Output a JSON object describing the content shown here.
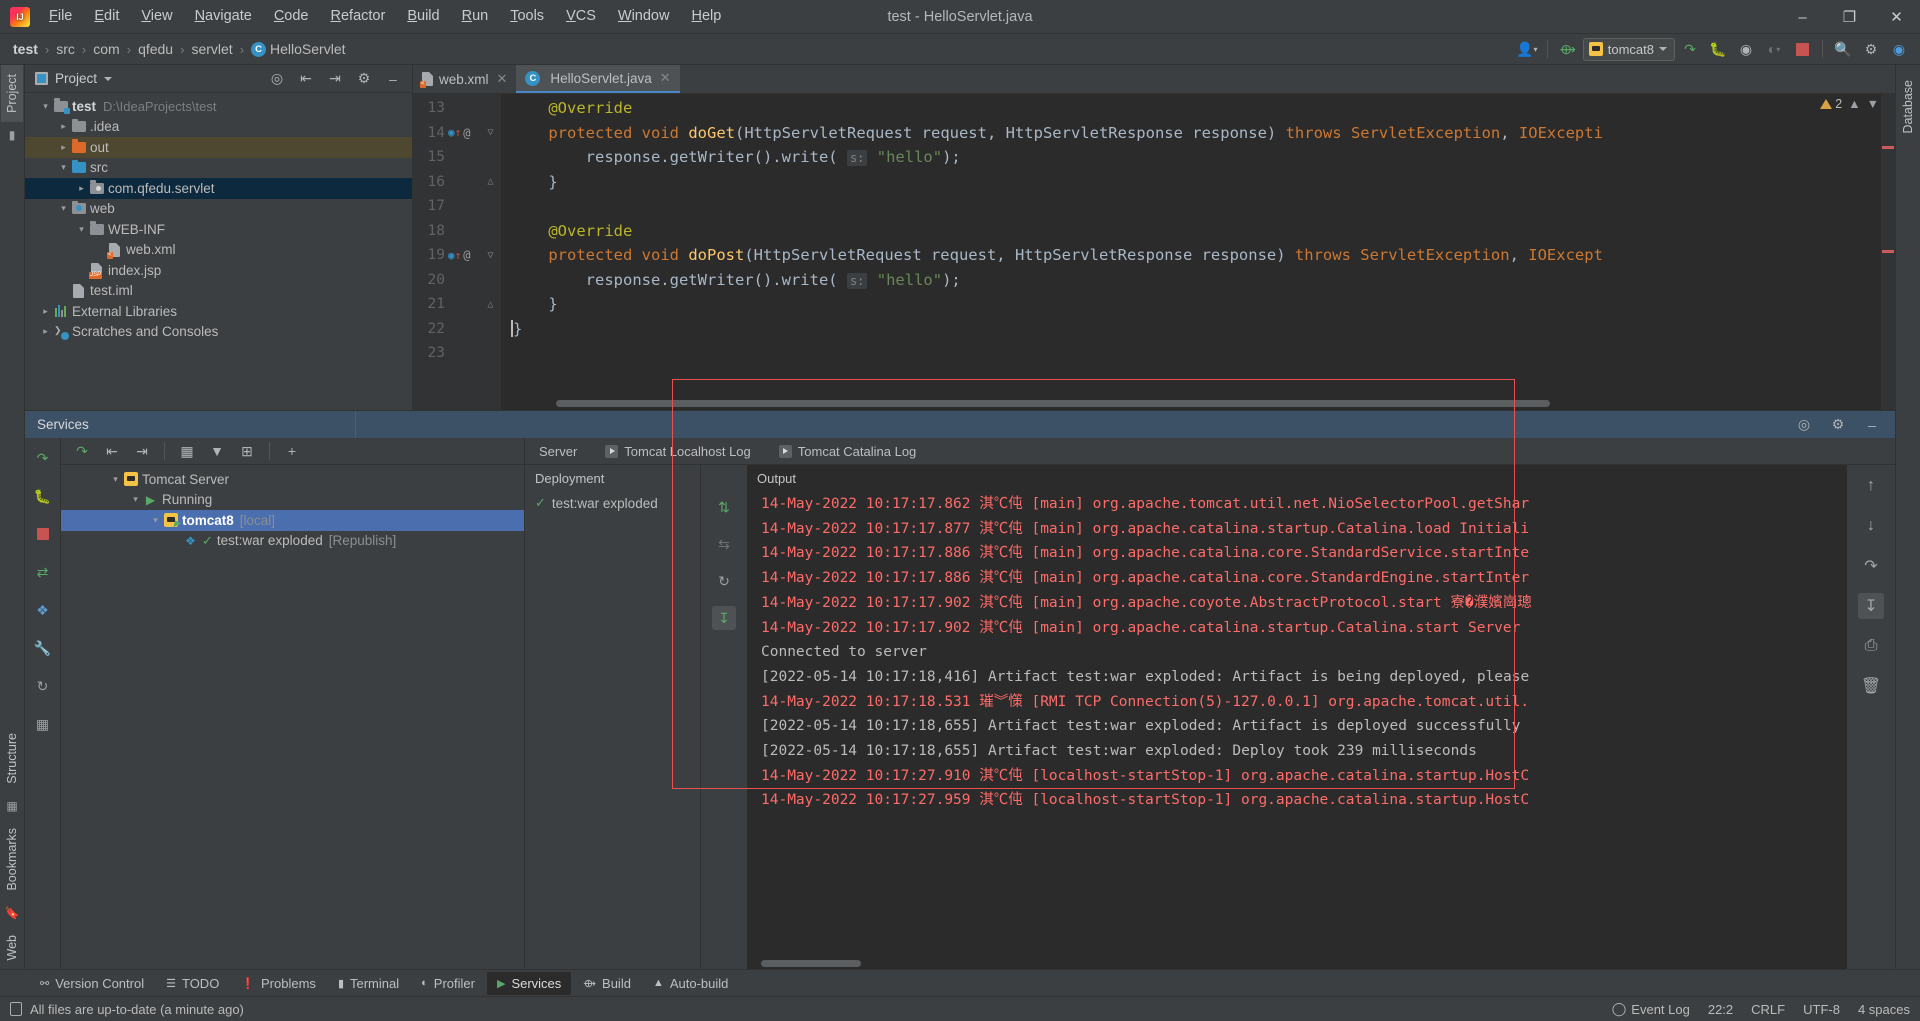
{
  "titlebar": {
    "logo_icon": "intellij-logo-icon",
    "window_title": "test - HelloServlet.java",
    "menus": [
      "File",
      "Edit",
      "View",
      "Navigate",
      "Code",
      "Refactor",
      "Build",
      "Run",
      "Tools",
      "VCS",
      "Window",
      "Help"
    ],
    "minimize_icon": "minimize-icon",
    "restore_icon": "restore-icon",
    "close_icon": "close-icon"
  },
  "navbar": {
    "breadcrumbs": [
      "test",
      "src",
      "com",
      "qfedu",
      "servlet",
      "HelloServlet"
    ],
    "class_badge": "C",
    "separator": "›",
    "run_config": "tomcat8",
    "icons": [
      "user-icon",
      "build-hammer-icon",
      "run-icon",
      "debug-icon",
      "run-coverage-icon",
      "profiler-icon",
      "stop-icon",
      "search-icon",
      "settings-gear-icon",
      "help-sphere-icon"
    ]
  },
  "left_rail": {
    "tabs": [
      "Project",
      "Structure",
      "Bookmarks",
      "Web"
    ],
    "active": "Project"
  },
  "right_rail": {
    "tabs": [
      "Database"
    ]
  },
  "project_panel": {
    "title": "Project",
    "dropdown_icon": "chevron-down-icon",
    "actions": [
      "target-locate-icon",
      "expand-all-icon",
      "collapse-all-icon",
      "settings-gear-icon",
      "hide-icon"
    ],
    "tree": [
      {
        "label": "test",
        "path": "D:\\IdeaProjects\\test",
        "depth": 0,
        "arrow": "down",
        "icon": "module-folder",
        "bold": true,
        "state": "normal"
      },
      {
        "label": ".idea",
        "path": "",
        "depth": 1,
        "arrow": "right",
        "icon": "folder-grey",
        "bold": false,
        "state": "normal"
      },
      {
        "label": "out",
        "path": "",
        "depth": 1,
        "arrow": "right",
        "icon": "folder-orange",
        "bold": false,
        "state": "highlight"
      },
      {
        "label": "src",
        "path": "",
        "depth": 1,
        "arrow": "down",
        "icon": "folder-blue",
        "bold": false,
        "state": "normal"
      },
      {
        "label": "com.qfedu.servlet",
        "path": "",
        "depth": 2,
        "arrow": "right",
        "icon": "package-folder",
        "bold": false,
        "state": "selected"
      },
      {
        "label": "web",
        "path": "",
        "depth": 1,
        "arrow": "down",
        "icon": "folder-web",
        "bold": false,
        "state": "normal"
      },
      {
        "label": "WEB-INF",
        "path": "",
        "depth": 2,
        "arrow": "down",
        "icon": "folder-grey",
        "bold": false,
        "state": "normal"
      },
      {
        "label": "web.xml",
        "path": "",
        "depth": 3,
        "arrow": "none",
        "icon": "xml-file",
        "bold": false,
        "state": "normal"
      },
      {
        "label": "index.jsp",
        "path": "",
        "depth": 2,
        "arrow": "none",
        "icon": "jsp-file",
        "bold": false,
        "state": "normal"
      },
      {
        "label": "test.iml",
        "path": "",
        "depth": 1,
        "arrow": "none",
        "icon": "iml-file",
        "bold": false,
        "state": "normal"
      },
      {
        "label": "External Libraries",
        "path": "",
        "depth": 0,
        "arrow": "right",
        "icon": "libraries-icon",
        "bold": false,
        "state": "normal"
      },
      {
        "label": "Scratches and Consoles",
        "path": "",
        "depth": 0,
        "arrow": "right",
        "icon": "scratches-icon",
        "bold": false,
        "state": "normal"
      }
    ]
  },
  "editor": {
    "tabs": [
      {
        "label": "web.xml",
        "icon": "xml-file-icon",
        "active": false
      },
      {
        "label": "HelloServlet.java",
        "icon": "java-class-icon",
        "active": true
      }
    ],
    "warning_count": "2",
    "warning_icon": "warning-triangle-icon",
    "lines": [
      {
        "num": "13",
        "overridden": false,
        "annot": false,
        "fold": "",
        "text": "    @Override"
      },
      {
        "num": "14",
        "overridden": true,
        "annot": true,
        "fold": "open",
        "text": "    protected void doGet(HttpServletRequest request, HttpServletResponse response) throws ServletException, IOExcepti"
      },
      {
        "num": "15",
        "overridden": false,
        "annot": false,
        "fold": "",
        "text": "        response.getWriter().write( s: \"hello\");"
      },
      {
        "num": "16",
        "overridden": false,
        "annot": false,
        "fold": "close",
        "text": "    }"
      },
      {
        "num": "17",
        "overridden": false,
        "annot": false,
        "fold": "",
        "text": ""
      },
      {
        "num": "18",
        "overridden": false,
        "annot": false,
        "fold": "",
        "text": "    @Override"
      },
      {
        "num": "19",
        "overridden": true,
        "annot": true,
        "fold": "open",
        "text": "    protected void doPost(HttpServletRequest request, HttpServletResponse response) throws ServletException, IOExcept"
      },
      {
        "num": "20",
        "overridden": false,
        "annot": false,
        "fold": "",
        "text": "        response.getWriter().write( s: \"hello\");"
      },
      {
        "num": "21",
        "overridden": false,
        "annot": false,
        "fold": "close",
        "text": "    }"
      },
      {
        "num": "22",
        "overridden": false,
        "annot": false,
        "fold": "",
        "text": "}"
      },
      {
        "num": "23",
        "overridden": false,
        "annot": false,
        "fold": "",
        "text": ""
      }
    ],
    "param_hint": "s:"
  },
  "services": {
    "title": "Services",
    "header_actions": [
      "target-locate-icon",
      "settings-gear-icon",
      "hide-icon"
    ],
    "toolbar_icons": [
      "rerun-icon",
      "expand-all-icon",
      "collapse-all-icon",
      "group-icon",
      "filter-icon",
      "add-frame-icon",
      "add-icon"
    ],
    "side_icons": [
      "rerun-service-icon",
      "debug-icon",
      "stop-icon",
      "redeploy-icon",
      "edit-config-icon",
      "wrench-icon",
      "refresh-icon",
      "chart-icon"
    ],
    "tree": [
      {
        "label": "Tomcat Server",
        "suffix": "",
        "depth": 0,
        "arrow": "down",
        "icon": "tomcat-icon",
        "state": "normal",
        "bold": false
      },
      {
        "label": "Running",
        "suffix": "",
        "depth": 1,
        "arrow": "down",
        "icon": "run-green-icon",
        "state": "normal",
        "bold": false
      },
      {
        "label": "tomcat8",
        "suffix": "[local]",
        "depth": 2,
        "arrow": "down",
        "icon": "tomcat-running-icon",
        "state": "selected",
        "bold": true
      },
      {
        "label": "test:war exploded",
        "suffix": "[Republish]",
        "depth": 3,
        "arrow": "none",
        "icon": "artifact-ok-icon",
        "state": "normal",
        "bold": false
      }
    ],
    "log_tabs": [
      {
        "label": "Server",
        "icon": "",
        "active": false
      },
      {
        "label": "Tomcat Localhost Log",
        "icon": "log-icon",
        "active": false
      },
      {
        "label": "Tomcat Catalina Log",
        "icon": "log-icon",
        "active": false
      }
    ],
    "deployment_header": "Deployment",
    "deployment_item": "test:war exploded",
    "output_header": "Output",
    "output_tool_icons": [
      "scroll-to-end-icon",
      "scroll-to-start-icon",
      "rerun-icon",
      "dump-icon"
    ],
    "right_tool_icons": [
      "up-arrow-icon",
      "down-arrow-icon",
      "soft-wrap-icon",
      "scroll-to-end-icon",
      "print-icon",
      "trash-icon"
    ],
    "console_lines": [
      {
        "text": "14-May-2022 10:17:17.862 淇℃伅 [main] org.apache.tomcat.util.net.NioSelectorPool.getShar",
        "type": "error"
      },
      {
        "text": "14-May-2022 10:17:17.877 淇℃伅 [main] org.apache.catalina.startup.Catalina.load Initiali",
        "type": "error"
      },
      {
        "text": "14-May-2022 10:17:17.886 淇℃伅 [main] org.apache.catalina.core.StandardService.startInte",
        "type": "error"
      },
      {
        "text": "14-May-2022 10:17:17.886 淇℃伅 [main] org.apache.catalina.core.StandardEngine.startInter",
        "type": "error"
      },
      {
        "text": "14-May-2022 10:17:17.902 淇℃伅 [main] org.apache.coyote.AbstractProtocol.start 寮�濮嬪崗璁",
        "type": "error"
      },
      {
        "text": "14-May-2022 10:17:17.902 淇℃伅 [main] org.apache.catalina.startup.Catalina.start Server",
        "type": "error"
      },
      {
        "text": "Connected to server",
        "type": "info"
      },
      {
        "text": "[2022-05-14 10:17:18,416] Artifact test:war exploded: Artifact is being deployed, please",
        "type": "info"
      },
      {
        "text": "14-May-2022 10:17:18.531 璀︾憡 [RMI TCP Connection(5)-127.0.0.1] org.apache.tomcat.util.",
        "type": "error"
      },
      {
        "text": "[2022-05-14 10:17:18,655] Artifact test:war exploded: Artifact is deployed successfully",
        "type": "info"
      },
      {
        "text": "[2022-05-14 10:17:18,655] Artifact test:war exploded: Deploy took 239 milliseconds",
        "type": "info"
      },
      {
        "text": "14-May-2022 10:17:27.910 淇℃伅 [localhost-startStop-1] org.apache.catalina.startup.HostC",
        "type": "error"
      },
      {
        "text": "14-May-2022 10:17:27.959 淇℃伅 [localhost-startStop-1] org.apache.catalina.startup.HostC",
        "type": "error"
      }
    ]
  },
  "toolwindow_bar": {
    "items": [
      {
        "label": "Version Control",
        "icon": "branch-icon",
        "active": false
      },
      {
        "label": "TODO",
        "icon": "list-icon",
        "active": false
      },
      {
        "label": "Problems",
        "icon": "exclamation-icon",
        "active": false
      },
      {
        "label": "Terminal",
        "icon": "terminal-icon",
        "active": false
      },
      {
        "label": "Profiler",
        "icon": "profiler-icon",
        "active": false
      },
      {
        "label": "Services",
        "icon": "services-icon",
        "active": true
      },
      {
        "label": "Build",
        "icon": "build-hammer-icon",
        "active": false
      },
      {
        "label": "Auto-build",
        "icon": "auto-build-icon",
        "active": false
      }
    ]
  },
  "statusbar": {
    "icon": "file-status-icon",
    "message": "All files are up-to-date (a minute ago)",
    "event_log": "Event Log",
    "event_log_icon": "event-log-icon",
    "caret_position": "22:2",
    "line_separator": "CRLF",
    "encoding": "UTF-8",
    "indent": "4 spaces"
  }
}
